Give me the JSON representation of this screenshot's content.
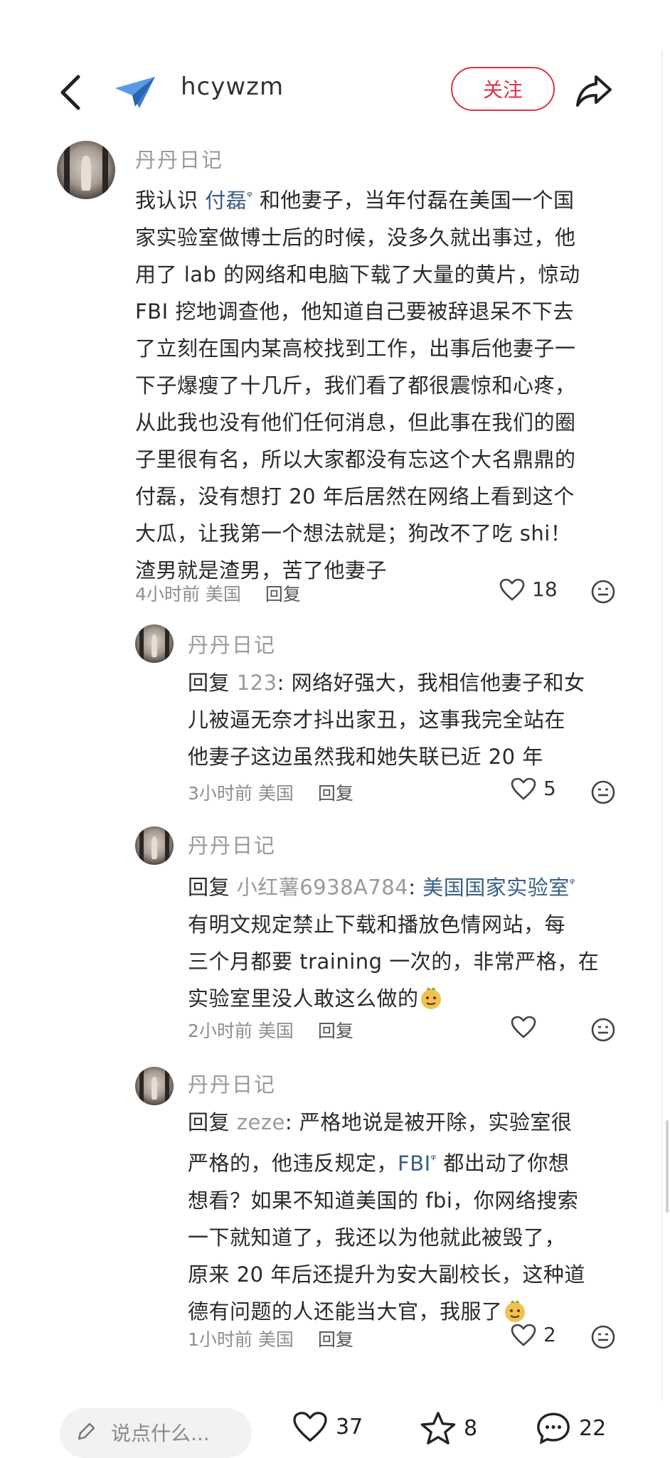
{
  "header": {
    "username": "hcywzm",
    "follow_label": "关注"
  },
  "comments": [
    {
      "name": "丹丹日记",
      "lines": [
        {
          "pre": "我认识 ",
          "link": "付磊",
          "post": " 和他妻子，当年付磊在美国一个国"
        },
        {
          "text": "家实验室做博士后的时候，没多久就出事过，他"
        },
        {
          "text": "用了 lab 的网络和电脑下载了大量的黄片，惊动"
        },
        {
          "text": "FBI 挖地调查他，他知道自己要被辞退呆不下去"
        },
        {
          "text": "了立刻在国内某高校找到工作，出事后他妻子一"
        },
        {
          "text": "下子爆瘦了十几斤，我们看了都很震惊和心疼，"
        },
        {
          "text": "从此我也没有他们任何消息，但此事在我们的圈"
        },
        {
          "text": "子里很有名，所以大家都没有忘这个大名鼎鼎的"
        },
        {
          "text": "付磊，没有想打 20 年后居然在网络上看到这个"
        },
        {
          "text": "大瓜，让我第一个想法就是；狗改不了吃 shi！"
        },
        {
          "text": "渣男就是渣男，苦了他妻子"
        }
      ],
      "time": "4小时前",
      "location": "美国",
      "reply_label": "回复",
      "likes": "18"
    },
    {
      "name": "丹丹日记",
      "reply_prefix": "回复 ",
      "reply_to": "123",
      "first_rest": ": 网络好强大，我相信他妻子和女",
      "lines": [
        "儿被逼无奈才抖出家丑，这事我完全站在",
        "他妻子这边虽然我和她失联已近 20 年"
      ],
      "time": "3小时前",
      "location": "美国",
      "reply_label": "回复",
      "likes": "5"
    },
    {
      "name": "丹丹日记",
      "reply_prefix": "回复 ",
      "reply_to": "小红薯6938A784",
      "first_sep": ": ",
      "first_link": "美国国家实验室",
      "lines": [
        "有明文规定禁止下载和播放色情网站，每",
        "三个月都要 training 一次的，非常严格，在",
        "实验室里没人敢这么做的"
      ],
      "time": "2小时前",
      "location": "美国",
      "reply_label": "回复",
      "likes": ""
    },
    {
      "name": "丹丹日记",
      "reply_prefix": "回复 ",
      "reply_to": "zeze",
      "first_rest": ": 严格地说是被开除，实验室很",
      "second_pre": "严格的，他违反规定，",
      "second_link": "FBI",
      "second_post": " 都出动了你想",
      "lines": [
        "想看？如果不知道美国的 fbi，你网络搜索",
        "一下就知道了，我还以为他就此被毁了，",
        "原来 20 年后还提升为安大副校长，这种道",
        "德有问题的人还能当大官，我服了"
      ],
      "time": "1小时前",
      "location": "美国",
      "reply_label": "回复",
      "likes": "2"
    }
  ],
  "bottom": {
    "placeholder": "说点什么...",
    "likes": "37",
    "stars": "8",
    "comments": "22"
  }
}
